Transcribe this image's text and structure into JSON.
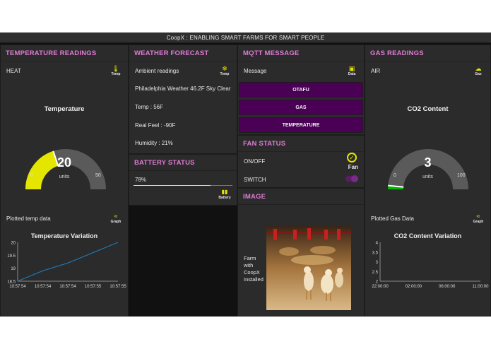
{
  "app": {
    "title": "CoopX : ENABLING SMART FARMS FOR SMART PEOPLE"
  },
  "temperature": {
    "title": "TEMPERATURE READINGS",
    "heat_label": "HEAT",
    "heat_icon": "thermometer-icon",
    "heat_icon_label": "Temp",
    "gauge_title": "Temperature",
    "gauge_value": "20",
    "gauge_units": "units",
    "gauge_min": "0",
    "gauge_max": "50",
    "gauge_level": 0.4,
    "gauge_color": "#e5e600",
    "plotted_label": "Plotted temp data",
    "plotted_icon": "line-chart-icon",
    "plotted_icon_label": "Graph"
  },
  "weather": {
    "title": "WEATHER FORECAST",
    "ambient_label": "Ambient readings",
    "ambient_icon": "snowflake-icon",
    "ambient_icon_label": "Temp",
    "line1": "Philadelphia Weather 46.2F Sky Clear",
    "line2": "Temp : 56F",
    "line3": "Real Feel : -90F",
    "line4": "Humidity : 21%"
  },
  "battery": {
    "title": "BATTERY STATUS",
    "level_text": "78%",
    "level": 0.78,
    "icon": "battery-icon",
    "icon_label": "Battery"
  },
  "mqtt": {
    "title": "MQTT MESSAGE",
    "message_label": "Message",
    "message_icon": "square-icon",
    "message_icon_label": "Data",
    "btn1": "OTAFU",
    "btn2": "GAS",
    "btn3": "TEMPERATURE",
    "btn_color": "#4a0055"
  },
  "fan": {
    "title": "FAN STATUS",
    "onoff_label": "ON/OFF",
    "onoff_icon": "check-circle-icon",
    "onoff_icon_label": "Fan",
    "switch_label": "SWITCH",
    "switch_on": true
  },
  "image": {
    "title": "IMAGE",
    "caption_l1": "Farm",
    "caption_l2": "with",
    "caption_l3": "CoopX",
    "caption_l4": "Installed"
  },
  "gas": {
    "title": "GAS READINGS",
    "air_label": "AIR",
    "air_icon": "cloud-icon",
    "air_icon_label": "Gas",
    "gauge_title": "CO2 Content",
    "gauge_value": "3",
    "gauge_units": "units",
    "gauge_min": "0",
    "gauge_max": "100",
    "gauge_level": 0.03,
    "gauge_color": "#00b400",
    "plotted_label": "Plotted Gas Data",
    "plotted_icon": "line-chart-icon",
    "plotted_icon_label": "Graph"
  },
  "chart_data": [
    {
      "type": "line",
      "title": "Temperature Variation",
      "x": [
        "10:57:54",
        "10:57:54",
        "10:57:54",
        "10:57:55",
        "10:57:55"
      ],
      "series": [
        {
          "values": [
            18.5,
            18.9,
            19.2,
            19.6,
            20
          ]
        }
      ],
      "yticks": [
        "20",
        "19.5",
        "19",
        "18.5"
      ],
      "ylim": [
        18.5,
        20
      ],
      "line_color": "#1f77b4"
    },
    {
      "type": "line",
      "title": "CO2 Content Variation",
      "x": [
        "22:00:00",
        "02:00:00",
        "06:00:00",
        "11:00:00"
      ],
      "series": [],
      "yticks": [
        "4",
        "3.5",
        "3",
        "2.5",
        "2"
      ],
      "ylim": [
        2,
        4
      ]
    }
  ]
}
